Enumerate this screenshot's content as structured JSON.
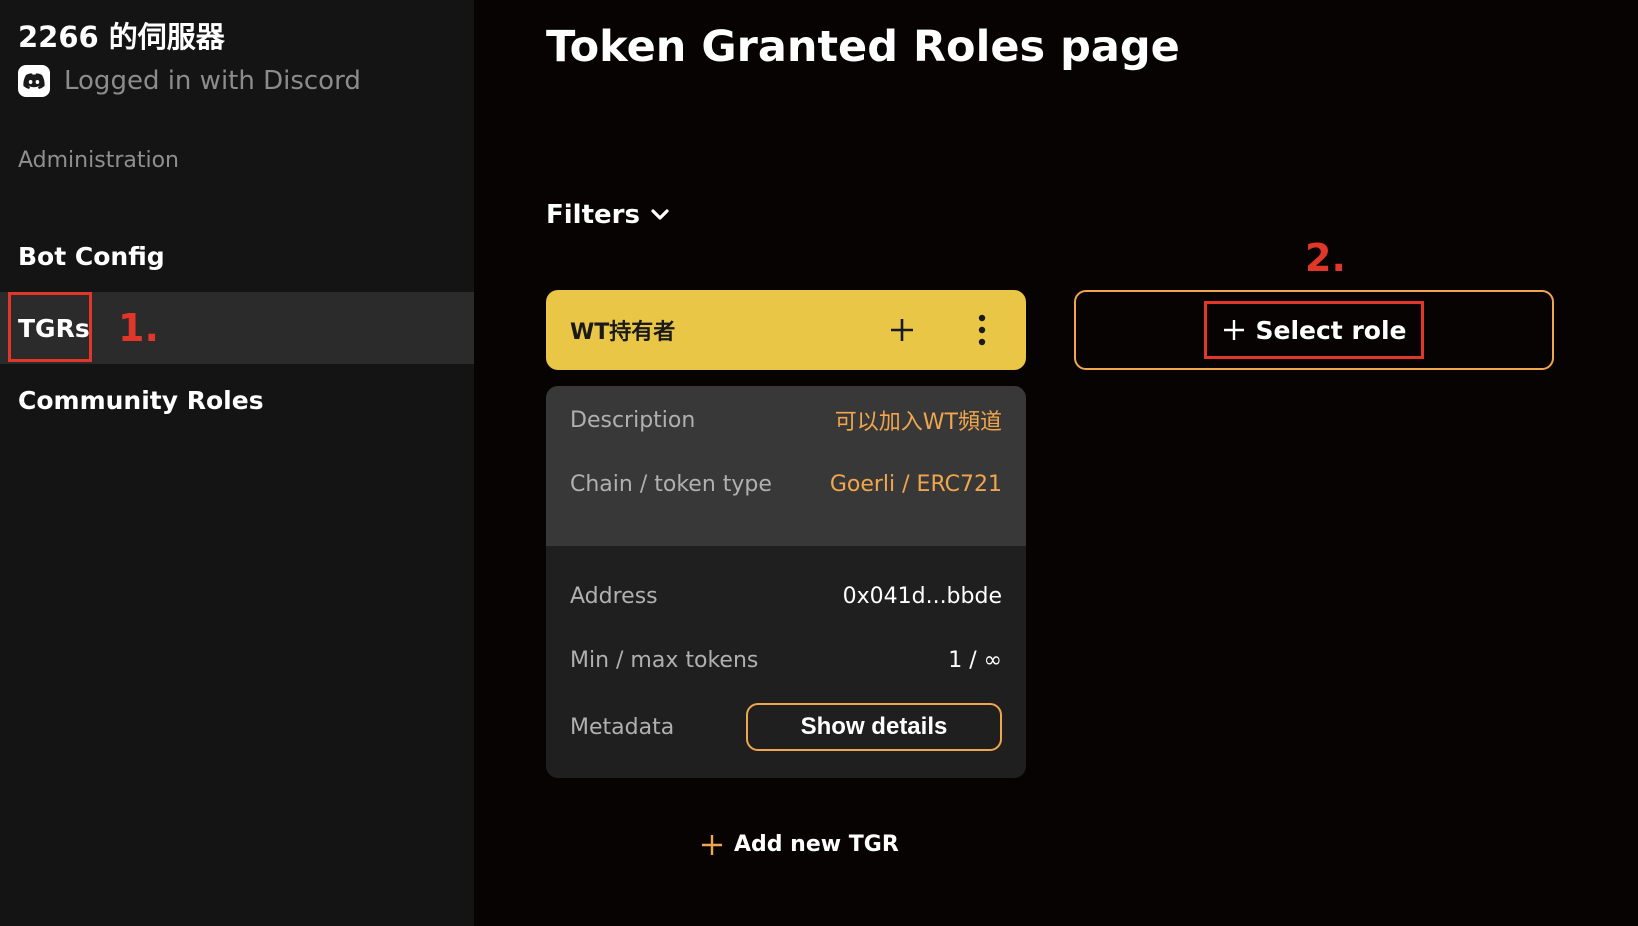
{
  "sidebar": {
    "server_name": "2266 的伺服器",
    "login_text": "Logged in with Discord",
    "section_label": "Administration",
    "items": [
      {
        "label": "Bot Config"
      },
      {
        "label": "TGRs"
      },
      {
        "label": "Community Roles"
      }
    ]
  },
  "annotations": {
    "step1": "1.",
    "step2": "2."
  },
  "main": {
    "title": "Token Granted Roles page",
    "filters_label": "Filters",
    "tgr": {
      "name": "WT持有者",
      "description_label": "Description",
      "description_value": "可以加入WT頻道",
      "chain_label": "Chain / token type",
      "chain_value": "Goerli / ERC721",
      "address_label": "Address",
      "address_value": "0x041d...bbde",
      "minmax_label": "Min / max tokens",
      "minmax_value": "1 / ∞",
      "metadata_label": "Metadata",
      "show_details_label": "Show details"
    },
    "select_role_label": "Select role",
    "add_tgr_label": "Add new TGR"
  },
  "colors": {
    "accent_orange": "#f0a64c",
    "card_yellow": "#e9c646",
    "annotation_red": "#e1362a"
  },
  "icons": [
    "discord-icon",
    "chevron-down-icon",
    "plus-icon",
    "more-vertical-icon"
  ]
}
